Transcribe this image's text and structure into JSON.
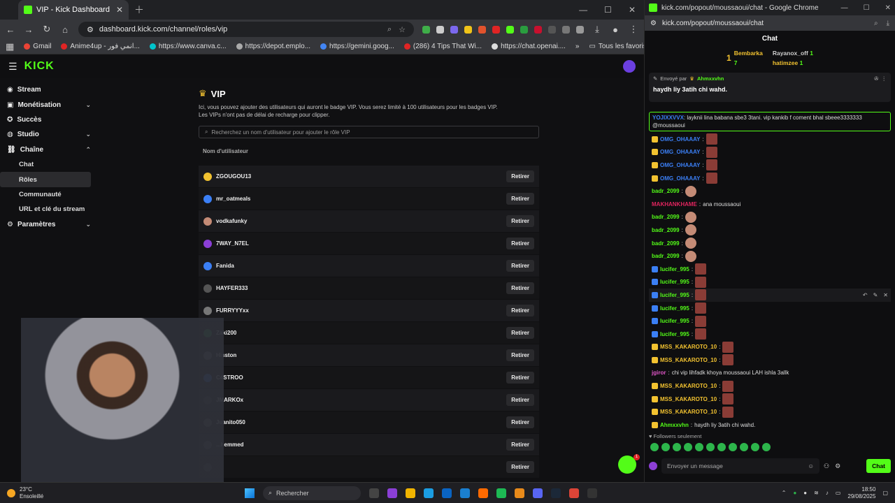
{
  "browser_left": {
    "tab_title": "VIP - Kick Dashboard",
    "url": "dashboard.kick.com/channel/roles/vip",
    "bookmarks": [
      "Gmail",
      "Anime4up - انمي فور...",
      "https://www.canva.c...",
      "https://depot.emplo...",
      "https://gemini.goog...",
      "(286) 4 Tips That Wi...",
      "https://chat.openai...."
    ],
    "bookmarks_all": "Tous les favoris"
  },
  "kick": {
    "logo": "KICK",
    "sidebar": {
      "stream": "Stream",
      "monetisation": "Monétisation",
      "succes": "Succès",
      "studio": "Studio",
      "chaine": "Chaîne",
      "chat": "Chat",
      "roles": "Rôles",
      "communaute": "Communauté",
      "url_cle": "URL et clé du stream",
      "parametres": "Paramètres"
    },
    "vip": {
      "title": "VIP",
      "desc1": "Ici, vous pouvez ajouter des utilisateurs qui auront le badge VIP. Vous serez limité à 100 utilisateurs pour les badges VIP.",
      "desc2": "Les VIPs n'ont pas de délai de recharge pour clipper.",
      "search_placeholder": "Recherchez un nom d'utilisateur pour ajouter le rôle VIP",
      "col_username": "Nom d'utilisateur",
      "remove_label": "Retirer",
      "users": [
        "ZGOUGOU13",
        "mr_oatmeals",
        "vodkafunky",
        "7WAY_N7EL",
        "Fanida",
        "HAYFER333",
        "FURRYYYxx",
        "Zaki200",
        "Hisston",
        "C4STROO",
        "JMARKOx",
        "Juanito050",
        "...hemmed",
        ""
      ]
    },
    "fab_count": "1"
  },
  "browser_right": {
    "title": "kick.com/popout/moussaoui/chat - Google Chrome",
    "url": "kick.com/popout/moussaoui/chat",
    "chat_title": "Chat",
    "leaders": {
      "rank": "1",
      "first_name": "Bembarka",
      "first_count": "7",
      "second_name": "Rayanox_off",
      "second_count": "1",
      "third_name": "hatimzee",
      "third_count": "1"
    },
    "pinned": {
      "sent_by": "Envoyé par",
      "author": "Ahmxxvhn",
      "message": "haydh liy 3atih chi wahd."
    },
    "highlight_user": "YOJIXXVVX",
    "highlight_text": "layknii lina babana sbe3 3tani. vip kankib f coment bhal sbeee3333333 @moussaoui",
    "messages": [
      {
        "user": "OMG_OHAAAY",
        "color": "#3b7ff5",
        "text": "",
        "emote": true
      },
      {
        "user": "OMG_OHAAAY",
        "color": "#3b7ff5",
        "text": "",
        "emote": true
      },
      {
        "user": "OMG_OHAAAY",
        "color": "#3b7ff5",
        "text": "",
        "emote": true
      },
      {
        "user": "OMG_OHAAAY",
        "color": "#3b7ff5",
        "text": "",
        "emote": true
      },
      {
        "user": "badr_2099",
        "color": "#53fc18",
        "text": "",
        "emote": true
      },
      {
        "user": "MAKHANKHAME",
        "color": "#e0245e",
        "text": "ana moussaoui",
        "emote": false
      },
      {
        "user": "badr_2099",
        "color": "#53fc18",
        "text": "",
        "emote": true
      },
      {
        "user": "badr_2099",
        "color": "#53fc18",
        "text": "",
        "emote": true
      },
      {
        "user": "badr_2099",
        "color": "#53fc18",
        "text": "",
        "emote": true
      },
      {
        "user": "badr_2099",
        "color": "#53fc18",
        "text": "",
        "emote": true
      },
      {
        "user": "lucifer_995",
        "color": "#53fc18",
        "text": "",
        "emote": true
      },
      {
        "user": "lucifer_995",
        "color": "#53fc18",
        "text": "",
        "emote": true
      },
      {
        "user": "lucifer_995",
        "color": "#53fc18",
        "text": "",
        "emote": true
      },
      {
        "user": "lucifer_995",
        "color": "#53fc18",
        "text": "",
        "emote": true
      },
      {
        "user": "lucifer_995",
        "color": "#53fc18",
        "text": "",
        "emote": true
      },
      {
        "user": "lucifer_995",
        "color": "#53fc18",
        "text": "",
        "emote": true
      },
      {
        "user": "MSS_KAKAROTO_10",
        "color": "#f2c230",
        "text": "",
        "emote": true
      },
      {
        "user": "MSS_KAKAROTO_10",
        "color": "#f2c230",
        "text": "",
        "emote": true
      },
      {
        "user": "jgiror",
        "color": "#e056c8",
        "text": "chi vip lihfadk khoya moussaoui LAH ishla 3allk",
        "emote": false
      },
      {
        "user": "MSS_KAKAROTO_10",
        "color": "#f2c230",
        "text": "",
        "emote": true
      },
      {
        "user": "MSS_KAKAROTO_10",
        "color": "#f2c230",
        "text": "",
        "emote": true
      },
      {
        "user": "MSS_KAKAROTO_10",
        "color": "#f2c230",
        "text": "",
        "emote": true
      },
      {
        "user": "Ahmxxvhn",
        "color": "#53fc18",
        "text": "haydh liy 3atih chi wahd.",
        "emote": false
      }
    ],
    "followers_only": "Followers seulement",
    "input_placeholder": "Envoyer un message",
    "chat_button": "Chat"
  },
  "taskbar": {
    "temp": "23°C",
    "weather": "Ensoleillé",
    "search_placeholder": "Rechercher",
    "time": "18:50",
    "date": "29/08/2025"
  },
  "colors": {
    "accent": "#53fc18",
    "vip_gold": "#f2c230"
  }
}
